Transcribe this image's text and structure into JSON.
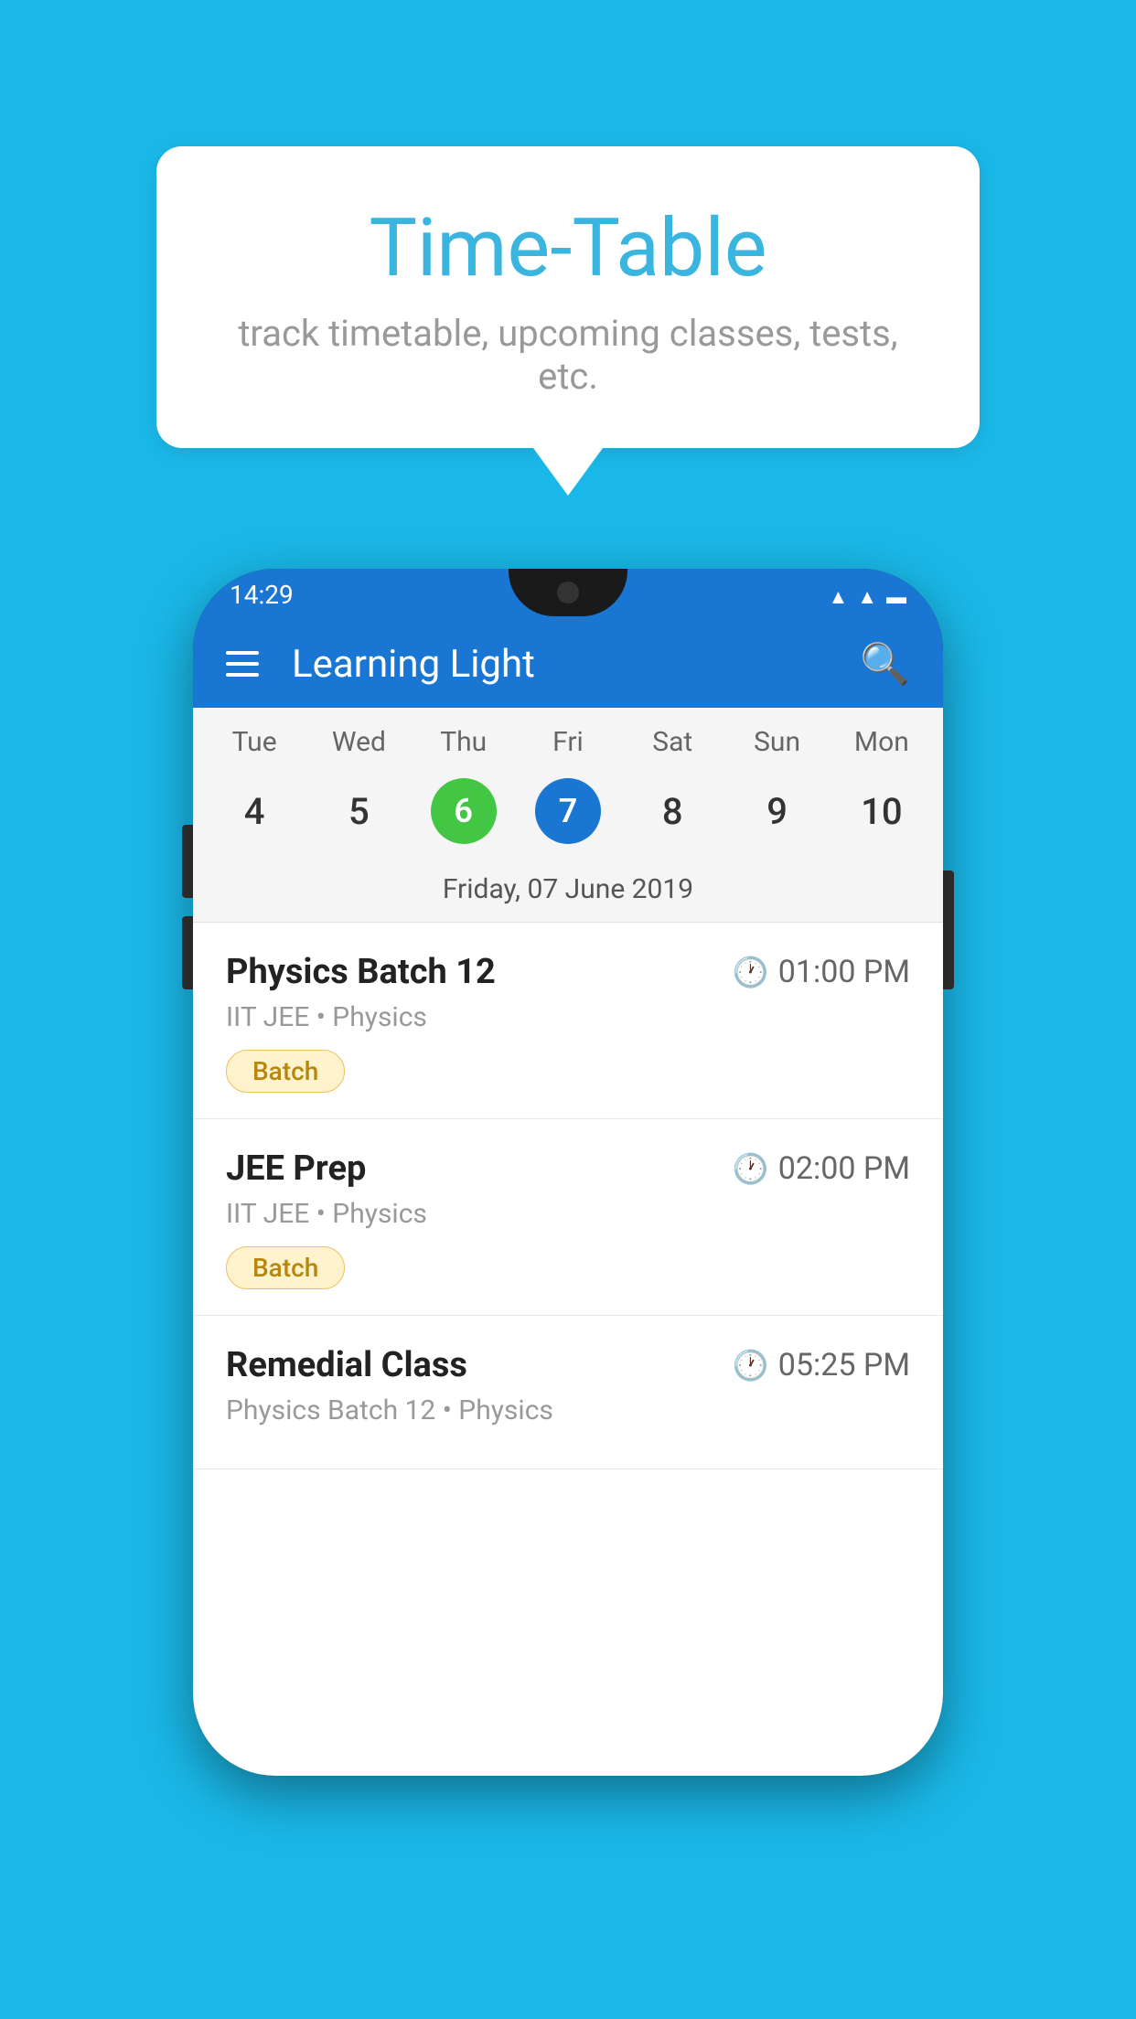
{
  "background_color": "#1ab8e8",
  "speech_bubble": {
    "title": "Time-Table",
    "subtitle": "track timetable, upcoming classes, tests, etc."
  },
  "phone": {
    "status_bar": {
      "time": "14:29"
    },
    "app_bar": {
      "title": "Learning Light"
    },
    "calendar": {
      "days": [
        "Tue",
        "Wed",
        "Thu",
        "Fri",
        "Sat",
        "Sun",
        "Mon"
      ],
      "dates": [
        "4",
        "5",
        "6",
        "7",
        "8",
        "9",
        "10"
      ],
      "today_index": 2,
      "selected_index": 3,
      "selected_label": "Friday, 07 June 2019"
    },
    "classes": [
      {
        "name": "Physics Batch 12",
        "time": "01:00 PM",
        "meta": "IIT JEE • Physics",
        "badge": "Batch"
      },
      {
        "name": "JEE Prep",
        "time": "02:00 PM",
        "meta": "IIT JEE • Physics",
        "badge": "Batch"
      },
      {
        "name": "Remedial Class",
        "time": "05:25 PM",
        "meta": "Physics Batch 12 • Physics",
        "badge": ""
      }
    ]
  }
}
